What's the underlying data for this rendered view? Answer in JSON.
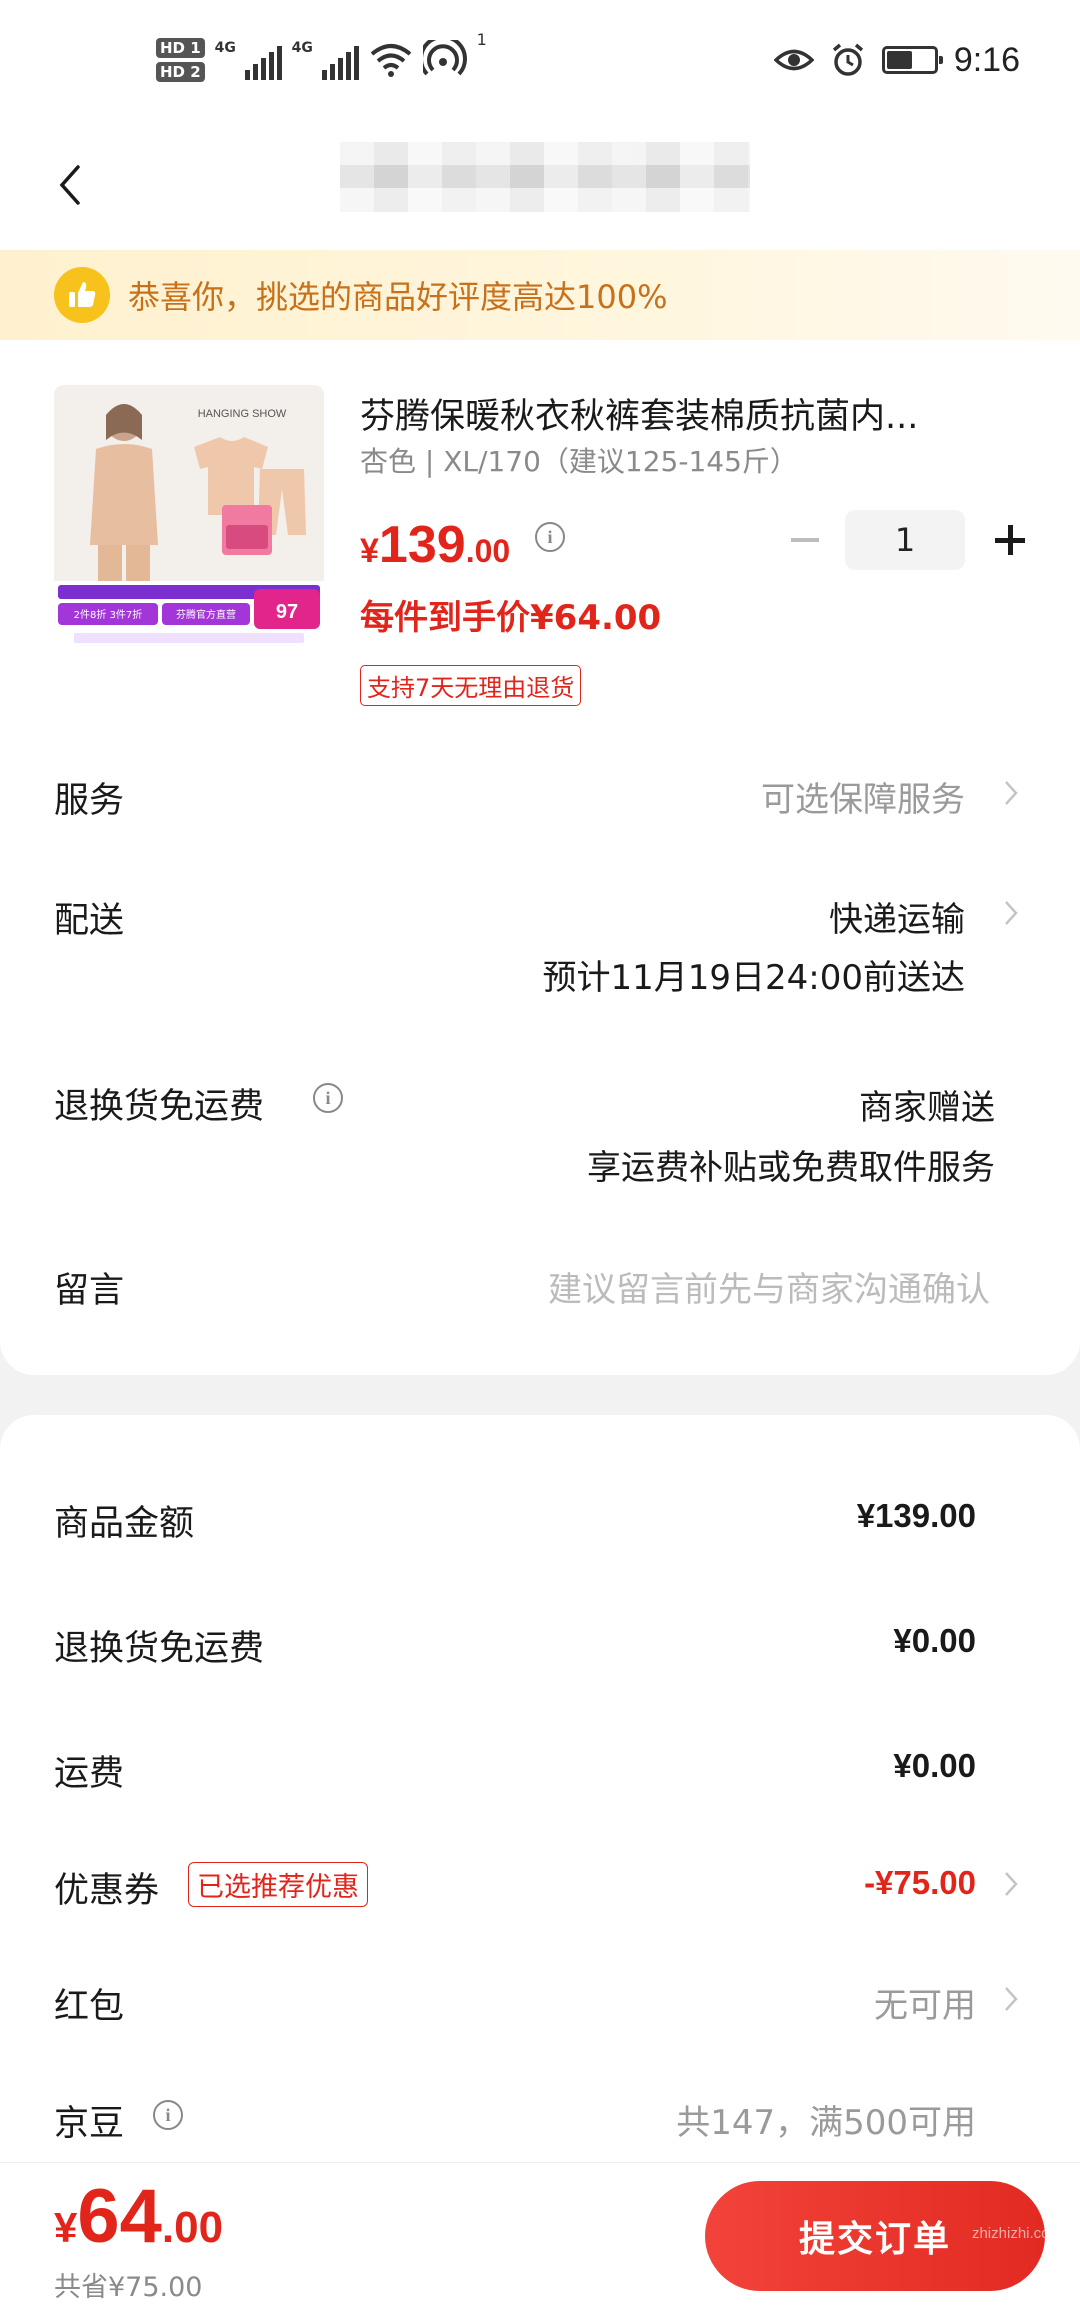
{
  "status_bar": {
    "hd1": "HD 1",
    "hd2": "HD 2",
    "net1": "4G",
    "net2": "4G",
    "hotspot_count": "1",
    "time": "9:16",
    "battery_level": 0.55
  },
  "banner": {
    "text": "恭喜你，挑选的商品好评度高达100%"
  },
  "product": {
    "title": "芬腾保暖秋衣秋裤套装棉质抗菌内...",
    "spec": "杏色 | XL/170（建议125-145斤）",
    "price_currency": "¥",
    "price_int": "139",
    "price_dec": ".00",
    "each_price": "每件到手价¥64.00",
    "return_tag": "支持7天无理由退货",
    "quantity": "1",
    "image_caption": "HANGING SHOW",
    "image_promo_price": "97",
    "image_promo_left": "2件8折 3件7折",
    "image_promo_right": "芬腾官方直营"
  },
  "rows": {
    "service_label": "服务",
    "service_value": "可选保障服务",
    "delivery_label": "配送",
    "delivery_value": "快递运输",
    "delivery_eta": "预计11月19日24:00前送达",
    "return_label": "退换货免运费",
    "return_value": "商家赠送",
    "return_sub": "享运费补贴或免费取件服务",
    "message_label": "留言",
    "message_placeholder": "建议留言前先与商家沟通确认"
  },
  "summary": {
    "goods_label": "商品金额",
    "goods_value": "¥139.00",
    "return_fee_label": "退换货免运费",
    "return_fee_value": "¥0.00",
    "shipping_label": "运费",
    "shipping_value": "¥0.00",
    "coupon_label": "优惠券",
    "coupon_tag": "已选推荐优惠",
    "coupon_value": "-¥75.00",
    "redpacket_label": "红包",
    "redpacket_value": "无可用",
    "jingdou_label": "京豆",
    "jingdou_value": "共147，满500可用"
  },
  "footer": {
    "total_currency": "¥",
    "total_int": "64",
    "total_dec": ".00",
    "saved": "共省¥75.00",
    "submit_label": "提交订单",
    "watermark": "zhizhizhi.com"
  },
  "colors": {
    "accent_red": "#e1251b",
    "banner_text": "#c7711b",
    "banner_icon": "#f7c21b"
  }
}
